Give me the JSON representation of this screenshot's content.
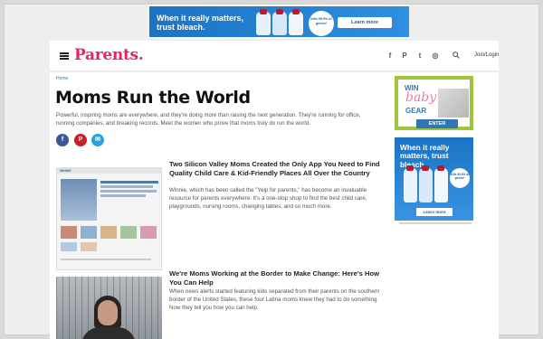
{
  "top_ad": {
    "headline": "When it really matters, trust bleach.",
    "kills_badge": "Kills 99.9% of germs*",
    "cta": "Learn more"
  },
  "nav": {
    "logo": "Parents.",
    "social": [
      "f",
      "P",
      "t",
      "◎"
    ],
    "auth": "Join/Login"
  },
  "breadcrumb": "Home",
  "page": {
    "title": "Moms Run the World",
    "description": "Powerful, inspiring moms are everywhere, and they're doing more than raising the next generation. They're running for office, running companies, and breaking records. Meet the women who prove that moms truly do run the world."
  },
  "share": {
    "facebook": "f",
    "pinterest": "P",
    "email": "✉"
  },
  "articles": [
    {
      "title": "Two Silicon Valley Moms Created the Only App You Need to Find Quality Child Care & Kid-Friendly Places All Over the Country",
      "description": "Winnie, which has been called the \"Yelp for parents,\" has become an invaluable resource for parents everywhere. It's a one-stop shop to find the best child care, playgrounds, nursing rooms, changing tables, and so much more.",
      "thumb_brand": "WINNIE"
    },
    {
      "title": "We're Moms Working at the Border to Make Change: Here's How You Can Help",
      "description": "When news alerts started featuring kids separated from their parents on the southern border of the United States, these four Latina moms knew they had to do something. Now they tell you how you can help."
    }
  ],
  "sidebar_ad_1": {
    "win": "WIN",
    "baby": "baby",
    "gear": "GEAR",
    "cta": "ENTER"
  },
  "sidebar_ad_2": {
    "headline": "When it really matters, trust bleach.",
    "kills_badge": "Kills 99.9% of germs*",
    "cta": "Learn more"
  },
  "colors": {
    "brand": "#e5236d",
    "bleach_blue": "#1b73c4",
    "ad_green": "#9ec63d"
  }
}
